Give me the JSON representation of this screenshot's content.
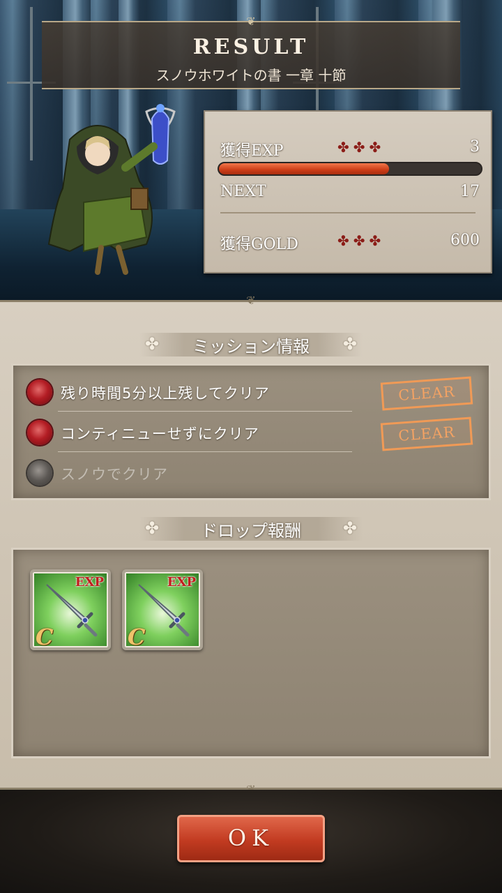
{
  "header": {
    "title": "RESULT",
    "subtitle": "スノウホワイトの書 一章 十節"
  },
  "stats": {
    "exp_label": "獲得EXP",
    "exp_pips": "✤✤✤",
    "exp_value": "3",
    "exp_progress": 0.65,
    "next_label": "NEXT",
    "next_value": "17",
    "gold_label": "獲得GOLD",
    "gold_pips": "✤✤✤",
    "gold_value": "600"
  },
  "missions": {
    "heading": "ミッション情報",
    "items": [
      {
        "text": "残り時間5分以上残してクリア",
        "status": "CLEAR"
      },
      {
        "text": "コンティニューせずにクリア",
        "status": "CLEAR"
      },
      {
        "text": "スノウでクリア",
        "status": ""
      }
    ]
  },
  "drops": {
    "heading": "ドロップ報酬",
    "items": [
      {
        "tag": "EXP",
        "rank": "C"
      },
      {
        "tag": "EXP",
        "rank": "C"
      }
    ]
  },
  "ok_label": "OK",
  "colors": {
    "accent_red": "#c23b21",
    "clear_stamp": "#f09a56",
    "exp_fill": "#cc3d17",
    "parchment": "#d8cfc1"
  }
}
